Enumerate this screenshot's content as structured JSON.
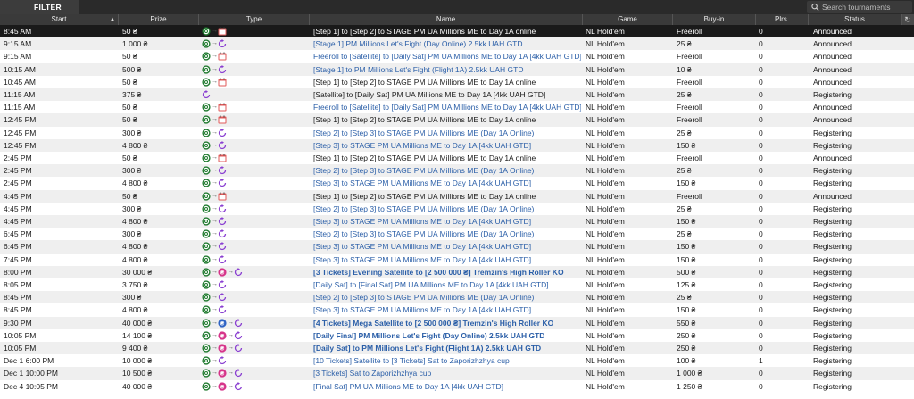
{
  "toolbar": {
    "filter_label": "FILTER"
  },
  "search": {
    "placeholder": "Search tournaments"
  },
  "columns": [
    "Start",
    "Prize",
    "Type",
    "Name",
    "Game",
    "Buy-in",
    "Plrs.",
    "Status"
  ],
  "icons": {
    "sort": "sort-ascending-icon",
    "refresh": "refresh-icon",
    "search": "search-icon"
  },
  "rows": [
    {
      "start": "8:45 AM",
      "prize": "50 ₴",
      "types": [
        "chip",
        "calendar"
      ],
      "name": "[Step 1] to [Step 2] to STAGE PM UA Millions ME to Day 1A online",
      "game": "NL Hold'em",
      "buyin": "Freeroll",
      "players": "0",
      "status": "Announced",
      "link": false
    },
    {
      "start": "9:15 AM",
      "prize": "1 000 ₴",
      "types": [
        "chip",
        "rebuy"
      ],
      "name": "[Stage 1] PM Millions Let's Fight (Day Online) 2.5kk UAH GTD",
      "game": "NL Hold'em",
      "buyin": "25 ₴",
      "players": "0",
      "status": "Announced",
      "link": true
    },
    {
      "start": "9:15 AM",
      "prize": "50 ₴",
      "types": [
        "chip",
        "calendar"
      ],
      "name": "Freeroll to [Satellite] to [Daily Sat] PM UA Millions ME to Day 1A [4kk UAH GTD]",
      "game": "NL Hold'em",
      "buyin": "Freeroll",
      "players": "0",
      "status": "Announced",
      "link": true
    },
    {
      "start": "10:15 AM",
      "prize": "500 ₴",
      "types": [
        "chip",
        "rebuy"
      ],
      "name": "[Stage 1] to PM Millions Let's Fight (Flight 1A) 2.5kk UAH GTD",
      "game": "NL Hold'em",
      "buyin": "10 ₴",
      "players": "0",
      "status": "Announced",
      "link": true
    },
    {
      "start": "10:45 AM",
      "prize": "50 ₴",
      "types": [
        "chip",
        "calendar"
      ],
      "name": "[Step 1] to [Step 2] to STAGE PM UA Millions ME to Day 1A online",
      "game": "NL Hold'em",
      "buyin": "Freeroll",
      "players": "0",
      "status": "Announced",
      "link": false
    },
    {
      "start": "11:15 AM",
      "prize": "375 ₴",
      "types": [
        "rebuy"
      ],
      "name": "[Satellite] to [Daily Sat] PM UA Millions ME to Day 1A [4kk UAH GTD]",
      "game": "NL Hold'em",
      "buyin": "25 ₴",
      "players": "0",
      "status": "Registering",
      "link": false
    },
    {
      "start": "11:15 AM",
      "prize": "50 ₴",
      "types": [
        "chip",
        "calendar"
      ],
      "name": "Freeroll to [Satellite] to [Daily Sat] PM UA Millions ME to Day 1A [4kk UAH GTD]",
      "game": "NL Hold'em",
      "buyin": "Freeroll",
      "players": "0",
      "status": "Announced",
      "link": true
    },
    {
      "start": "12:45 PM",
      "prize": "50 ₴",
      "types": [
        "chip",
        "calendar"
      ],
      "name": "[Step 1] to [Step 2] to STAGE PM UA Millions ME to Day 1A online",
      "game": "NL Hold'em",
      "buyin": "Freeroll",
      "players": "0",
      "status": "Announced",
      "link": false
    },
    {
      "start": "12:45 PM",
      "prize": "300 ₴",
      "types": [
        "chip",
        "rebuy"
      ],
      "name": "[Step 2] to [Step 3] to STAGE PM UA Millions ME (Day 1A Online)",
      "game": "NL Hold'em",
      "buyin": "25 ₴",
      "players": "0",
      "status": "Registering",
      "link": true
    },
    {
      "start": "12:45 PM",
      "prize": "4 800 ₴",
      "types": [
        "chip",
        "rebuy"
      ],
      "name": "[Step 3] to STAGE PM UA Millions ME to Day 1A [4kk UAH GTD]",
      "game": "NL Hold'em",
      "buyin": "150 ₴",
      "players": "0",
      "status": "Registering",
      "link": true
    },
    {
      "start": "2:45 PM",
      "prize": "50 ₴",
      "types": [
        "chip",
        "calendar"
      ],
      "name": "[Step 1] to [Step 2] to STAGE PM UA Millions ME to Day 1A online",
      "game": "NL Hold'em",
      "buyin": "Freeroll",
      "players": "0",
      "status": "Announced",
      "link": false
    },
    {
      "start": "2:45 PM",
      "prize": "300 ₴",
      "types": [
        "chip",
        "rebuy"
      ],
      "name": "[Step 2] to [Step 3] to STAGE PM UA Millions ME (Day 1A Online)",
      "game": "NL Hold'em",
      "buyin": "25 ₴",
      "players": "0",
      "status": "Registering",
      "link": true
    },
    {
      "start": "2:45 PM",
      "prize": "4 800 ₴",
      "types": [
        "chip",
        "rebuy"
      ],
      "name": "[Step 3] to STAGE PM UA Millions ME to Day 1A [4kk UAH GTD]",
      "game": "NL Hold'em",
      "buyin": "150 ₴",
      "players": "0",
      "status": "Registering",
      "link": true
    },
    {
      "start": "4:45 PM",
      "prize": "50 ₴",
      "types": [
        "chip",
        "calendar"
      ],
      "name": "[Step 1] to [Step 2] to STAGE PM UA Millions ME to Day 1A online",
      "game": "NL Hold'em",
      "buyin": "Freeroll",
      "players": "0",
      "status": "Announced",
      "link": false
    },
    {
      "start": "4:45 PM",
      "prize": "300 ₴",
      "types": [
        "chip",
        "rebuy"
      ],
      "name": "[Step 2] to [Step 3] to STAGE PM UA Millions ME (Day 1A Online)",
      "game": "NL Hold'em",
      "buyin": "25 ₴",
      "players": "0",
      "status": "Registering",
      "link": true
    },
    {
      "start": "4:45 PM",
      "prize": "4 800 ₴",
      "types": [
        "chip",
        "rebuy"
      ],
      "name": "[Step 3] to STAGE PM UA Millions ME to Day 1A [4kk UAH GTD]",
      "game": "NL Hold'em",
      "buyin": "150 ₴",
      "players": "0",
      "status": "Registering",
      "link": true
    },
    {
      "start": "6:45 PM",
      "prize": "300 ₴",
      "types": [
        "chip",
        "rebuy"
      ],
      "name": "[Step 2] to [Step 3] to STAGE PM UA Millions ME (Day 1A Online)",
      "game": "NL Hold'em",
      "buyin": "25 ₴",
      "players": "0",
      "status": "Registering",
      "link": true
    },
    {
      "start": "6:45 PM",
      "prize": "4 800 ₴",
      "types": [
        "chip",
        "rebuy"
      ],
      "name": "[Step 3] to STAGE PM UA Millions ME to Day 1A [4kk UAH GTD]",
      "game": "NL Hold'em",
      "buyin": "150 ₴",
      "players": "0",
      "status": "Registering",
      "link": true
    },
    {
      "start": "7:45 PM",
      "prize": "4 800 ₴",
      "types": [
        "chip",
        "rebuy"
      ],
      "name": "[Step 3] to STAGE PM UA Millions ME to Day 1A [4kk UAH GTD]",
      "game": "NL Hold'em",
      "buyin": "150 ₴",
      "players": "0",
      "status": "Registering",
      "link": true
    },
    {
      "start": "8:00 PM",
      "prize": "30 000 ₴",
      "types": [
        "chip",
        "ticket",
        "rebuy"
      ],
      "name": "[3 Tickets] Evening Satellite to [2 500 000 ₴] Tremzin's High Roller KO",
      "game": "NL Hold'em",
      "buyin": "500 ₴",
      "players": "0",
      "status": "Registering",
      "link": true,
      "bold": true
    },
    {
      "start": "8:05 PM",
      "prize": "3 750 ₴",
      "types": [
        "chip",
        "rebuy"
      ],
      "name": "[Daily Sat] to [Final Sat] PM UA Millions ME to Day 1A [4kk UAH GTD]",
      "game": "NL Hold'em",
      "buyin": "125 ₴",
      "players": "0",
      "status": "Registering",
      "link": true
    },
    {
      "start": "8:45 PM",
      "prize": "300 ₴",
      "types": [
        "chip",
        "rebuy"
      ],
      "name": "[Step 2] to [Step 3] to STAGE PM UA Millions ME (Day 1A Online)",
      "game": "NL Hold'em",
      "buyin": "25 ₴",
      "players": "0",
      "status": "Registering",
      "link": true
    },
    {
      "start": "8:45 PM",
      "prize": "4 800 ₴",
      "types": [
        "chip",
        "rebuy"
      ],
      "name": "[Step 3] to STAGE PM UA Millions ME to Day 1A [4kk UAH GTD]",
      "game": "NL Hold'em",
      "buyin": "150 ₴",
      "players": "0",
      "status": "Registering",
      "link": true
    },
    {
      "start": "9:30 PM",
      "prize": "40 000 ₴",
      "types": [
        "chip",
        "ticket-blue",
        "rebuy"
      ],
      "name": "[4 Tickets] Mega Satellite to [2 500 000 ₴] Tremzin's High Roller KO",
      "game": "NL Hold'em",
      "buyin": "550 ₴",
      "players": "0",
      "status": "Registering",
      "link": true,
      "bold": true
    },
    {
      "start": "10:05 PM",
      "prize": "14 100 ₴",
      "types": [
        "chip",
        "ticket",
        "rebuy"
      ],
      "name": "[Daily Final] PM Millions Let's Fight (Day Online) 2.5kk UAH GTD",
      "game": "NL Hold'em",
      "buyin": "250 ₴",
      "players": "0",
      "status": "Registering",
      "link": true,
      "bold": true
    },
    {
      "start": "10:05 PM",
      "prize": "9 400 ₴",
      "types": [
        "chip",
        "ticket",
        "rebuy"
      ],
      "name": "[Daily Sat] to PM Millions Let's Fight (Flight 1A) 2.5kk UAH GTD",
      "game": "NL Hold'em",
      "buyin": "250 ₴",
      "players": "0",
      "status": "Registering",
      "link": true,
      "bold": true
    },
    {
      "start": "Dec 1 6:00 PM",
      "prize": "10 000 ₴",
      "types": [
        "chip",
        "rebuy"
      ],
      "name": "[10 Tickets] Satellite to [3 Tickets] Sat to Zaporizhzhya cup",
      "game": "NL Hold'em",
      "buyin": "100 ₴",
      "players": "1",
      "status": "Registering",
      "link": true
    },
    {
      "start": "Dec 1 10:00 PM",
      "prize": "10 500 ₴",
      "types": [
        "chip",
        "ticket",
        "rebuy"
      ],
      "name": "[3 Tickets] Sat to Zaporizhzhya cup",
      "game": "NL Hold'em",
      "buyin": "1 000 ₴",
      "players": "0",
      "status": "Registering",
      "link": true
    },
    {
      "start": "Dec 4 10:05 PM",
      "prize": "40 000 ₴",
      "types": [
        "chip",
        "ticket",
        "rebuy"
      ],
      "name": "[Final Sat] PM UA Millions ME to Day 1A [4kk UAH GTD]",
      "game": "NL Hold'em",
      "buyin": "1 250 ₴",
      "players": "0",
      "status": "Registering",
      "link": true
    }
  ]
}
